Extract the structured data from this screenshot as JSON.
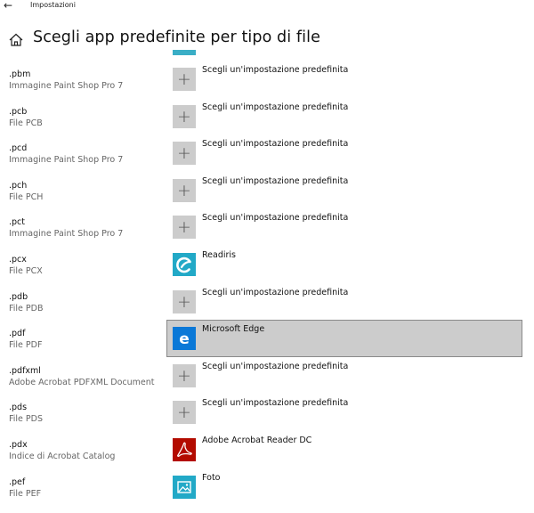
{
  "window": {
    "title": "Impostazioni",
    "back_icon": "back-arrow-icon"
  },
  "header": {
    "title": "Scegli app predefinite per tipo di file",
    "home_icon": "home-icon"
  },
  "colors": {
    "accent": "#3aaec6",
    "tile_gray": "#cccccc",
    "selected_bg": "#cccccc",
    "edge_blue": "#0a78d7",
    "acrobat_red": "#b30b00"
  },
  "rows": [
    {
      "ext": ".pbm",
      "desc": "Immagine Paint Shop Pro 7",
      "app": "Scegli un'impostazione predefinita",
      "icon": "plus-icon"
    },
    {
      "ext": ".pcb",
      "desc": "File PCB",
      "app": "Scegli un'impostazione predefinita",
      "icon": "plus-icon"
    },
    {
      "ext": ".pcd",
      "desc": "Immagine Paint Shop Pro 7",
      "app": "Scegli un'impostazione predefinita",
      "icon": "plus-icon"
    },
    {
      "ext": ".pch",
      "desc": "File PCH",
      "app": "Scegli un'impostazione predefinita",
      "icon": "plus-icon"
    },
    {
      "ext": ".pct",
      "desc": "Immagine Paint Shop Pro 7",
      "app": "Scegli un'impostazione predefinita",
      "icon": "plus-icon"
    },
    {
      "ext": ".pcx",
      "desc": "File PCX",
      "app": "Readiris",
      "icon": "readiris-icon"
    },
    {
      "ext": ".pdb",
      "desc": "File PDB",
      "app": "Scegli un'impostazione predefinita",
      "icon": "plus-icon"
    },
    {
      "ext": ".pdf",
      "desc": "File PDF",
      "app": "Microsoft Edge",
      "icon": "edge-icon",
      "selected": true
    },
    {
      "ext": ".pdfxml",
      "desc": "Adobe Acrobat PDFXML Document",
      "app": "Scegli un'impostazione predefinita",
      "icon": "plus-icon"
    },
    {
      "ext": ".pds",
      "desc": "File PDS",
      "app": "Scegli un'impostazione predefinita",
      "icon": "plus-icon"
    },
    {
      "ext": ".pdx",
      "desc": "Indice di Acrobat Catalog",
      "app": "Adobe Acrobat Reader DC",
      "icon": "acrobat-icon"
    },
    {
      "ext": ".pef",
      "desc": "File PEF",
      "app": "Foto",
      "icon": "photos-icon"
    }
  ]
}
